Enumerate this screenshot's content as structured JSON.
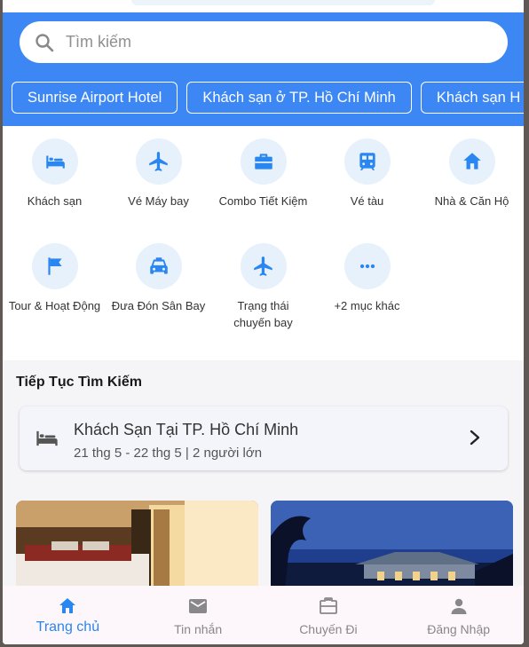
{
  "search": {
    "placeholder": "Tìm kiếm"
  },
  "quick_chips": [
    "Sunrise Airport Hotel",
    "Khách sạn ở TP. Hồ Chí Minh",
    "Khách sạn H"
  ],
  "services": [
    {
      "label": "Khách sạn",
      "icon": "bed-icon"
    },
    {
      "label": "Vé Máy bay",
      "icon": "airplane-icon"
    },
    {
      "label": "Combo Tiết Kiệm",
      "icon": "briefcase-icon"
    },
    {
      "label": "Vé tàu",
      "icon": "train-icon"
    },
    {
      "label": "Nhà & Căn Hộ",
      "icon": "home-icon"
    },
    {
      "label": "Tour & Hoạt Động",
      "icon": "flag-icon"
    },
    {
      "label": "Đưa Đón Sân Bay",
      "icon": "taxi-icon"
    },
    {
      "label": "Trạng thái chuyến bay",
      "icon": "airplane-icon"
    },
    {
      "label": "+2 mục khác",
      "icon": "more-icon"
    }
  ],
  "continue_search": {
    "title": "Tiếp Tục Tìm Kiếm",
    "card_title": "Khách Sạn Tại TP. Hồ Chí Minh",
    "card_sub": "21 thg 5 - 22 thg 5 | 2 người lớn"
  },
  "bottom_nav": [
    {
      "label": "Trang chủ",
      "icon": "home-icon",
      "active": true
    },
    {
      "label": "Tin nhắn",
      "icon": "mail-icon",
      "active": false
    },
    {
      "label": "Chuyến Đi",
      "icon": "briefcase-icon",
      "active": false
    },
    {
      "label": "Đăng Nhập",
      "icon": "person-icon",
      "active": false
    }
  ],
  "colors": {
    "brand": "#3d87f5",
    "icon_blue": "#2a86f0",
    "icon_bg": "#e6f1fc"
  }
}
